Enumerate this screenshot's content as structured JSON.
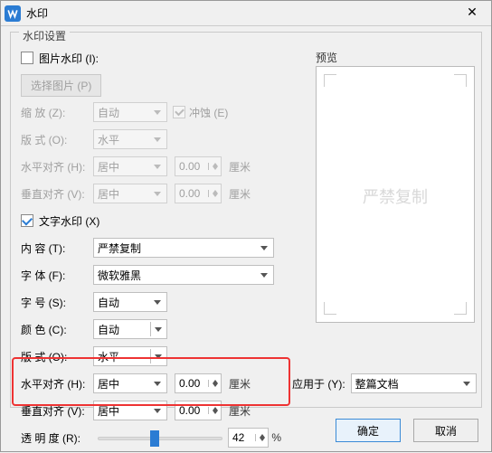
{
  "window": {
    "title": "水印",
    "close": "✕"
  },
  "group": {
    "legend": "水印设置"
  },
  "image": {
    "checkbox": "图片水印 (I):",
    "select_btn": "选择图片 (P)",
    "scale_label": "缩 放 (Z):",
    "scale_val": "自动",
    "washout": "冲蚀 (E)",
    "layout_label": "版 式 (O):",
    "layout_val": "水平",
    "halign_label": "水平对齐 (H):",
    "halign_val": "居中",
    "halign_num": "0.00",
    "halign_unit": "厘米",
    "valign_label": "垂直对齐 (V):",
    "valign_val": "居中",
    "valign_num": "0.00",
    "valign_unit": "厘米"
  },
  "text": {
    "checkbox": "文字水印 (X)",
    "content_label": "内 容 (T):",
    "content_val": "严禁复制",
    "font_label": "字 体 (F):",
    "font_val": "微软雅黑",
    "size_label": "字 号 (S):",
    "size_val": "自动",
    "color_label": "颜 色 (C):",
    "color_val": "自动",
    "layout_label": "版 式 (O):",
    "layout_val": "水平",
    "halign_label": "水平对齐 (H):",
    "halign_val": "居中",
    "halign_num": "0.00",
    "halign_unit": "厘米",
    "valign_label": "垂直对齐 (V):",
    "valign_val": "居中",
    "valign_num": "0.00",
    "valign_unit": "厘米",
    "opacity_label": "透 明 度 (R):",
    "opacity_val": "42",
    "opacity_unit": "%"
  },
  "preview": {
    "label": "预览",
    "watermark": "严禁复制"
  },
  "apply": {
    "label": "应用于 (Y):",
    "val": "整篇文档"
  },
  "footer": {
    "ok": "确定",
    "cancel": "取消"
  }
}
